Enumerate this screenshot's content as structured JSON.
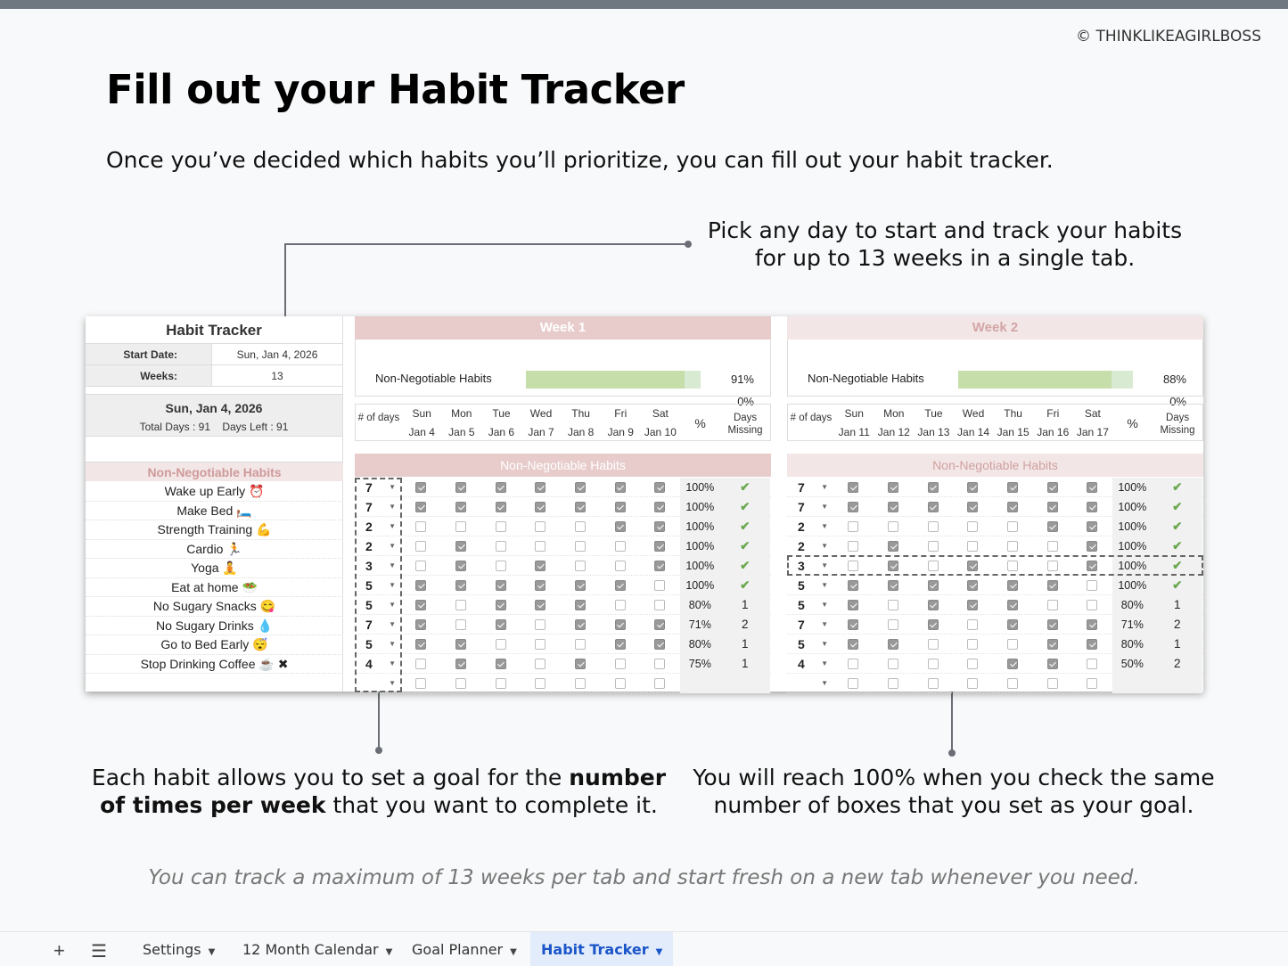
{
  "copyright": "© THINKLIKEAGIRLBOSS",
  "title": "Fill out your Habit Tracker",
  "subtitle": "Once you’ve decided which habits you’ll prioritize, you can fill out your habit tracker.",
  "callouts": {
    "top": "Pick any day to start and track your habits for up to 13 weeks in a single tab.",
    "left_pre": "Each habit allows you to set a goal for the ",
    "left_bold": "number of times per week",
    "left_post": " that you want to complete it.",
    "right": "You will reach 100% when you check the same number of boxes that you set as your goal."
  },
  "footnote": "You can track a maximum of 13 weeks per tab and start fresh on a new tab whenever you need.",
  "tracker": {
    "title": "Habit Tracker",
    "start_label": "Start Date:",
    "start_value": "Sun, Jan 4, 2026",
    "weeks_label": "Weeks:",
    "weeks_value": "13",
    "today": "Sun, Jan 4, 2026",
    "totals": "Total Days : 91    Days Left : 91",
    "habits_header": "Non-Negotiable Habits",
    "habits": [
      "Wake up Early ⏰",
      "Make Bed 🛏️",
      "Strength Training 💪",
      "Cardio 🏃",
      "Yoga 🧘",
      "Eat at home 🥗",
      "No Sugary Snacks 😋",
      "No Sugary Drinks 💧",
      "Go to Bed Early 😴",
      "Stop Drinking Coffee ☕ ✖"
    ]
  },
  "weeks": [
    {
      "title": "Week 1",
      "progress_label": "Non-Negotiable Habits",
      "progress_fraction": 0.91,
      "progress_pct": "91%",
      "progress_pct2": "0%",
      "num_days_label": "# of days",
      "pct_header": "%",
      "missing_header": "Days Missing",
      "days": [
        {
          "d": "Sun",
          "date": "Jan 4"
        },
        {
          "d": "Mon",
          "date": "Jan 5"
        },
        {
          "d": "Tue",
          "date": "Jan 6"
        },
        {
          "d": "Wed",
          "date": "Jan 7"
        },
        {
          "d": "Thu",
          "date": "Jan 8"
        },
        {
          "d": "Fri",
          "date": "Jan 9"
        },
        {
          "d": "Sat",
          "date": "Jan 10"
        }
      ],
      "section": "Non-Negotiable Habits",
      "rows": [
        {
          "goal": "7",
          "checks": [
            1,
            1,
            1,
            1,
            1,
            1,
            1
          ],
          "pct": "100%",
          "missing": "✔"
        },
        {
          "goal": "7",
          "checks": [
            1,
            1,
            1,
            1,
            1,
            1,
            1
          ],
          "pct": "100%",
          "missing": "✔"
        },
        {
          "goal": "2",
          "checks": [
            0,
            0,
            0,
            0,
            0,
            1,
            1
          ],
          "pct": "100%",
          "missing": "✔"
        },
        {
          "goal": "2",
          "checks": [
            0,
            1,
            0,
            0,
            0,
            0,
            1
          ],
          "pct": "100%",
          "missing": "✔"
        },
        {
          "goal": "3",
          "checks": [
            0,
            1,
            0,
            1,
            0,
            0,
            1
          ],
          "pct": "100%",
          "missing": "✔"
        },
        {
          "goal": "5",
          "checks": [
            1,
            1,
            1,
            1,
            1,
            1,
            0
          ],
          "pct": "100%",
          "missing": "✔"
        },
        {
          "goal": "5",
          "checks": [
            1,
            0,
            1,
            1,
            1,
            0,
            0
          ],
          "pct": "80%",
          "missing": "1"
        },
        {
          "goal": "7",
          "checks": [
            1,
            0,
            1,
            0,
            1,
            1,
            1
          ],
          "pct": "71%",
          "missing": "2"
        },
        {
          "goal": "5",
          "checks": [
            1,
            1,
            0,
            0,
            0,
            1,
            1
          ],
          "pct": "80%",
          "missing": "1"
        },
        {
          "goal": "4",
          "checks": [
            0,
            1,
            1,
            0,
            1,
            0,
            0
          ],
          "pct": "75%",
          "missing": "1"
        },
        {
          "goal": "",
          "checks": [
            0,
            0,
            0,
            0,
            0,
            0,
            0
          ],
          "pct": "",
          "missing": ""
        }
      ]
    },
    {
      "title": "Week 2",
      "progress_label": "Non-Negotiable Habits",
      "progress_fraction": 0.88,
      "progress_pct": "88%",
      "progress_pct2": "0%",
      "num_days_label": "# of days",
      "pct_header": "%",
      "missing_header": "Days Missing",
      "days": [
        {
          "d": "Sun",
          "date": "Jan 11"
        },
        {
          "d": "Mon",
          "date": "Jan 12"
        },
        {
          "d": "Tue",
          "date": "Jan 13"
        },
        {
          "d": "Wed",
          "date": "Jan 14"
        },
        {
          "d": "Thu",
          "date": "Jan 15"
        },
        {
          "d": "Fri",
          "date": "Jan 16"
        },
        {
          "d": "Sat",
          "date": "Jan 17"
        }
      ],
      "section": "Non-Negotiable Habits",
      "rows": [
        {
          "goal": "7",
          "checks": [
            1,
            1,
            1,
            1,
            1,
            1,
            1
          ],
          "pct": "100%",
          "missing": "✔"
        },
        {
          "goal": "7",
          "checks": [
            1,
            1,
            1,
            1,
            1,
            1,
            1
          ],
          "pct": "100%",
          "missing": "✔"
        },
        {
          "goal": "2",
          "checks": [
            0,
            0,
            0,
            0,
            0,
            1,
            1
          ],
          "pct": "100%",
          "missing": "✔"
        },
        {
          "goal": "2",
          "checks": [
            0,
            1,
            0,
            0,
            0,
            0,
            1
          ],
          "pct": "100%",
          "missing": "✔"
        },
        {
          "goal": "3",
          "checks": [
            0,
            1,
            0,
            1,
            0,
            0,
            1
          ],
          "pct": "100%",
          "missing": "✔"
        },
        {
          "goal": "5",
          "checks": [
            1,
            1,
            1,
            1,
            1,
            1,
            0
          ],
          "pct": "100%",
          "missing": "✔"
        },
        {
          "goal": "5",
          "checks": [
            1,
            0,
            1,
            1,
            1,
            0,
            0
          ],
          "pct": "80%",
          "missing": "1"
        },
        {
          "goal": "7",
          "checks": [
            1,
            0,
            1,
            0,
            1,
            1,
            1
          ],
          "pct": "71%",
          "missing": "2"
        },
        {
          "goal": "5",
          "checks": [
            1,
            1,
            0,
            0,
            0,
            1,
            1
          ],
          "pct": "80%",
          "missing": "1"
        },
        {
          "goal": "4",
          "checks": [
            0,
            0,
            0,
            0,
            1,
            1,
            0
          ],
          "pct": "50%",
          "missing": "2"
        },
        {
          "goal": "",
          "checks": [
            0,
            0,
            0,
            0,
            0,
            0,
            0
          ],
          "pct": "",
          "missing": ""
        }
      ]
    }
  ],
  "tabbar": {
    "add_icon": "plus-icon",
    "menu_icon": "menu-icon",
    "tabs": [
      "Settings",
      "12 Month Calendar",
      "Goal Planner",
      "Habit Tracker"
    ],
    "active_tab": "Habit Tracker"
  },
  "colors": {
    "week_header": "#e8cccc",
    "progress_fill": "#c6dea9",
    "check_green": "#6aa84f",
    "active_tab": "#1a55c9"
  }
}
